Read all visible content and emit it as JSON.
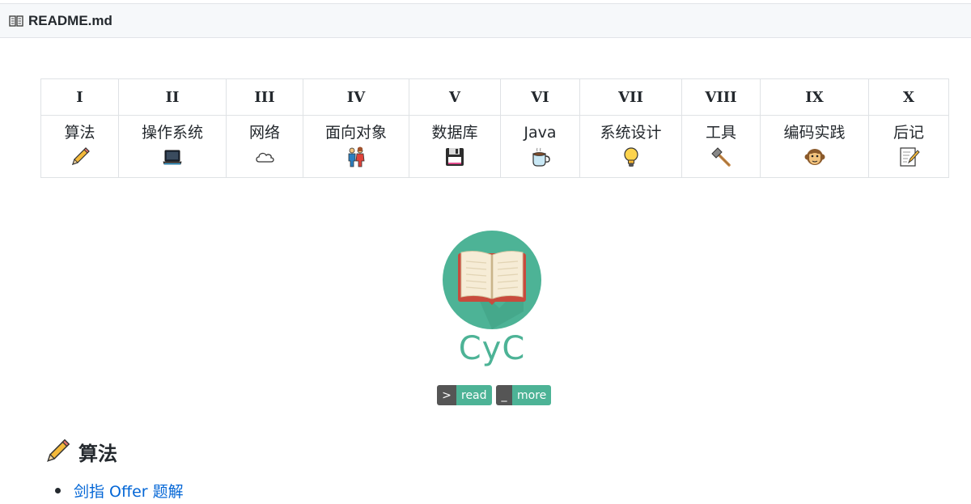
{
  "file_header": {
    "file_name": "README.md",
    "icon": "book-icon"
  },
  "toc": {
    "columns": [
      {
        "numeral": "I",
        "label": "算法",
        "icon": "pencil-icon"
      },
      {
        "numeral": "II",
        "label": "操作系统",
        "icon": "laptop-icon"
      },
      {
        "numeral": "III",
        "label": "网络",
        "icon": "cloud-icon"
      },
      {
        "numeral": "IV",
        "label": "面向对象",
        "icon": "couple-icon"
      },
      {
        "numeral": "V",
        "label": "数据库",
        "icon": "floppy-disk-icon"
      },
      {
        "numeral": "VI",
        "label": "Java",
        "icon": "coffee-icon"
      },
      {
        "numeral": "VII",
        "label": "系统设计",
        "icon": "light-bulb-icon"
      },
      {
        "numeral": "VIII",
        "label": "工具",
        "icon": "hammer-icon"
      },
      {
        "numeral": "IX",
        "label": "编码实践",
        "icon": "monkey-icon"
      },
      {
        "numeral": "X",
        "label": "后记",
        "icon": "memo-icon"
      }
    ]
  },
  "brand": {
    "name": "CyC",
    "logo_icon": "open-book-icon"
  },
  "badges": [
    {
      "left": ">",
      "right": "read"
    },
    {
      "left": "_",
      "right": "more"
    }
  ],
  "section": {
    "title": "算法",
    "icon": "pencil-icon"
  },
  "links": [
    {
      "label": "剑指 Offer 题解"
    }
  ],
  "colors": {
    "accent": "#4db396",
    "link": "#0366d6",
    "badge_dark": "#555555"
  }
}
